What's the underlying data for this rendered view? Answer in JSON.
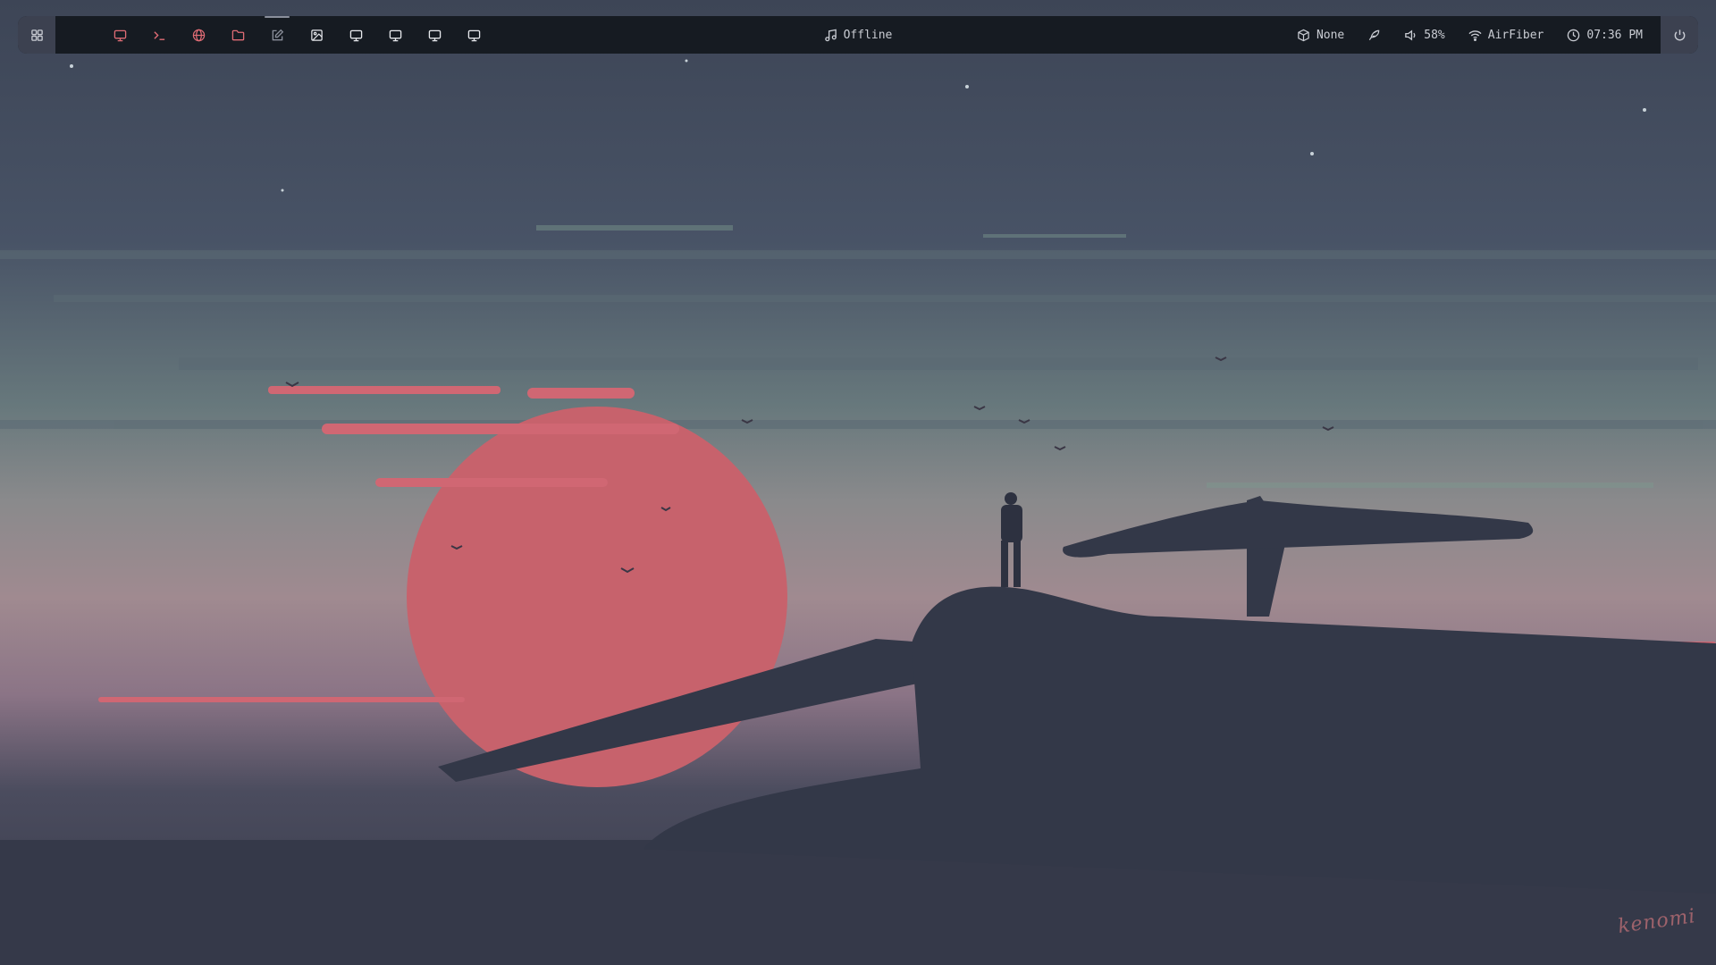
{
  "colors": {
    "bar_bg": "#161b22",
    "bar_text": "#c9ccd3",
    "accent_red": "#e06c75",
    "icon_gray": "#8a8f9b",
    "sun": "#c7626c",
    "silhouette": "#333848",
    "sky_top": "#3f4758",
    "sky_mid": "#6b7a80"
  },
  "topbar": {
    "launcher_icon": "grid-icon",
    "workspaces": [
      {
        "icon": "monitor-icon",
        "color": "accent"
      },
      {
        "icon": "terminal-icon",
        "color": "accent"
      },
      {
        "icon": "globe-icon",
        "color": "accent"
      },
      {
        "icon": "folder-icon",
        "color": "accent"
      },
      {
        "icon": "edit-icon",
        "color": "gray",
        "active": true
      },
      {
        "icon": "image-icon",
        "color": "white"
      },
      {
        "icon": "monitor-icon",
        "color": "white"
      },
      {
        "icon": "monitor-icon",
        "color": "white"
      },
      {
        "icon": "monitor-icon",
        "color": "white"
      },
      {
        "icon": "monitor-icon",
        "color": "white"
      }
    ],
    "media": {
      "icon": "music-icon",
      "status": "Offline"
    },
    "package": {
      "icon": "package-icon",
      "label": "None"
    },
    "feather": {
      "icon": "feather-icon"
    },
    "volume": {
      "icon": "volume-icon",
      "label": "58%"
    },
    "wifi": {
      "icon": "wifi-icon",
      "label": "AirFiber"
    },
    "clock": {
      "icon": "clock-icon",
      "time": "07:36 PM"
    },
    "power_icon": "power-icon"
  },
  "wallpaper": {
    "signature": "kenomi"
  }
}
